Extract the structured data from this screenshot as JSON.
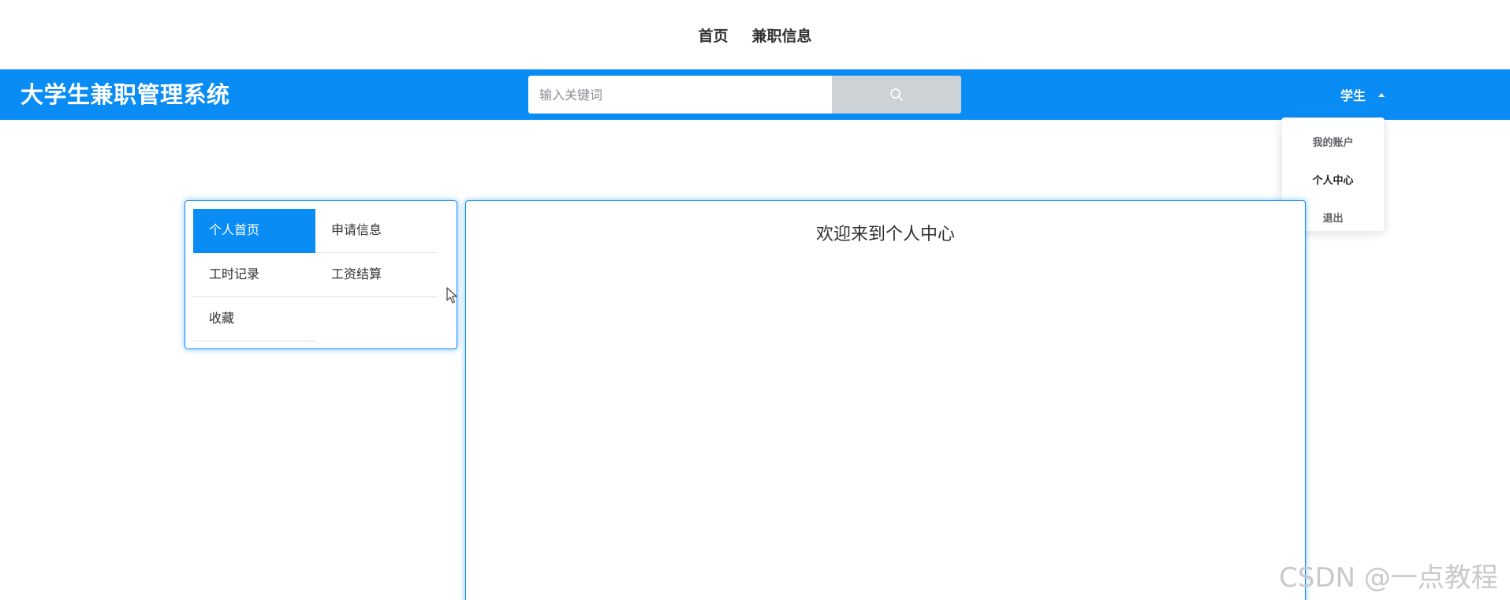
{
  "top_nav": {
    "items": [
      {
        "label": "首页"
      },
      {
        "label": "兼职信息"
      }
    ]
  },
  "header": {
    "brand": "大学生兼职管理系统",
    "search": {
      "placeholder": "输入关键词",
      "value": ""
    },
    "user_menu": {
      "label": "学生"
    }
  },
  "dropdown": {
    "items": [
      {
        "label": "我的账户"
      },
      {
        "label": "个人中心"
      },
      {
        "label": "退出"
      }
    ]
  },
  "sidebar": {
    "items": [
      {
        "label": "个人首页",
        "active": true
      },
      {
        "label": "申请信息"
      },
      {
        "label": "工时记录"
      },
      {
        "label": "工资结算"
      },
      {
        "label": "收藏"
      }
    ]
  },
  "main": {
    "welcome": "欢迎来到个人中心"
  },
  "watermark": "CSDN @一点教程",
  "colors": {
    "primary": "#0a8cf5",
    "search_button": "#cdd2d7",
    "text": "#303133"
  },
  "icons": {
    "search": "search-icon",
    "caret": "caret-up-icon",
    "cursor": "mouse-pointer-icon"
  }
}
